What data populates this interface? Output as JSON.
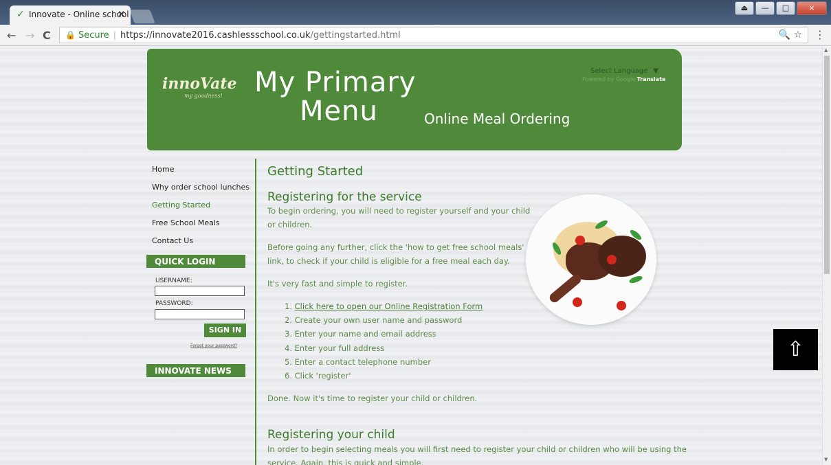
{
  "browser": {
    "tab_title": "Innovate - Online school",
    "tab_close": "×",
    "window_buttons": [
      "⏏",
      "—",
      "□",
      "×"
    ],
    "nav": {
      "back": "←",
      "forward": "→",
      "reload": "C"
    },
    "security_label": "Secure",
    "url_host": "https://innovate2016.cashlessschool.co.uk",
    "url_path": "/gettingstarted.html",
    "omnibox_icons": "🔍 ☆",
    "menu": "⋮"
  },
  "banner": {
    "logo": "innoVate",
    "logo_tagline": "my goodness!",
    "title_line1": "My Primary",
    "title_line2": "Menu",
    "subtitle": "Online Meal Ordering",
    "translate_select": "Select Language",
    "translate_caret": "▼",
    "powered_by": "Powered by Google",
    "translate_word": "Translate"
  },
  "nav_items": [
    {
      "label": "Home"
    },
    {
      "label": "Why order school lunches"
    },
    {
      "label": "Getting Started"
    },
    {
      "label": "Free School Meals"
    },
    {
      "label": "Contact Us"
    }
  ],
  "quick_login": {
    "heading": "QUICK LOGIN",
    "username_label": "USERNAME:",
    "password_label": "PASSWORD:",
    "signin": "SIGN IN",
    "forgot": "Forgot your password?"
  },
  "news_heading": "INNOVATE NEWS",
  "main": {
    "heading": "Getting Started",
    "section1_heading": "Registering for the service",
    "p1_line1": "To begin ordering, you will need to register yourself and your child",
    "p1_line2": "or children.",
    "p2_line1": "Before going any further, click the 'how to get free school meals'",
    "p2_line2": "link, to check if your child is eligible for a free meal each day.",
    "p3": "It's very fast and simple to register.",
    "steps": [
      "1. ",
      "Click here to open our Online Registration Form",
      "2. Create your own user name and password",
      "3. Enter your name and email address",
      "4. Enter your full address",
      "5. Enter a contact telephone number",
      "6. Click 'register'"
    ],
    "done": "Done. Now it's time to register your child or children.",
    "section2_heading": "Registering your child",
    "p4": "In order to begin selecting meals you will first need to register your child or children who will be using the",
    "p5": "service. Again, this is quick and simple."
  },
  "back_to_top": "⇧"
}
